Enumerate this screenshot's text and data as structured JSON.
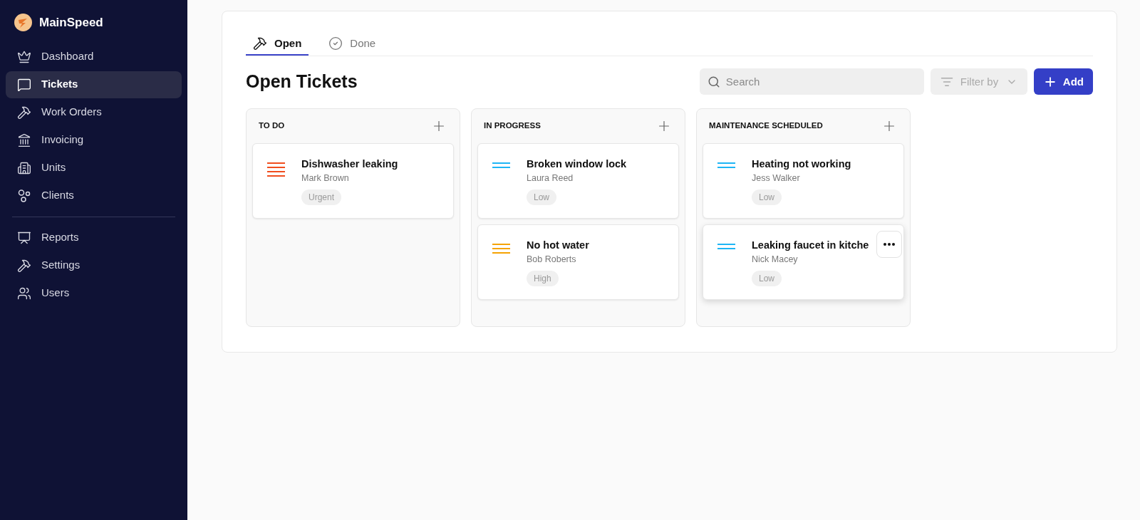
{
  "sidebar": {
    "brand": "MainSpeed",
    "items": [
      {
        "label": "Dashboard",
        "kind": "crown",
        "selected": false
      },
      {
        "label": "Tickets",
        "kind": "chat",
        "selected": true
      },
      {
        "label": "Work Orders",
        "kind": "hammer",
        "selected": false
      },
      {
        "label": "Invoicing",
        "kind": "bank",
        "selected": false
      },
      {
        "label": "Units",
        "kind": "building",
        "selected": false
      },
      {
        "label": "Clients",
        "kind": "circles",
        "selected": false
      }
    ],
    "bottom_items": [
      {
        "label": "Reports",
        "kind": "chart",
        "selected": false
      },
      {
        "label": "Settings",
        "kind": "hammer",
        "selected": false
      },
      {
        "label": "Users",
        "kind": "users",
        "selected": false
      }
    ]
  },
  "tabs": [
    {
      "label": "Open",
      "kind": "hammer",
      "selected": true
    },
    {
      "label": "Done",
      "kind": "check",
      "selected": false
    }
  ],
  "title": "Open Tickets",
  "search": {
    "placeholder": "Search"
  },
  "filter": {
    "placeholder": "Filter by"
  },
  "add_button": "Add",
  "columns": [
    {
      "title": "TO DO",
      "cards": [
        {
          "title": "Dishwasher leaking",
          "person": "Mark Brown",
          "priority": "Urgent",
          "kind": "urgent",
          "show_menu": false
        }
      ]
    },
    {
      "title": "IN PROGRESS",
      "cards": [
        {
          "title": "Broken window lock",
          "person": "Laura Reed",
          "priority": "Low",
          "kind": "low",
          "show_menu": false
        },
        {
          "title": "No hot water",
          "person": "Bob Roberts",
          "priority": "High",
          "kind": "high",
          "show_menu": false
        }
      ]
    },
    {
      "title": "MAINTENANCE SCHEDULED",
      "cards": [
        {
          "title": "Heating not working",
          "person": "Jess Walker",
          "priority": "Low",
          "kind": "low",
          "show_menu": false
        },
        {
          "title": "Leaking faucet in kitche",
          "person": "Nick Macey",
          "priority": "Low",
          "kind": "low",
          "show_menu": true
        }
      ]
    }
  ]
}
